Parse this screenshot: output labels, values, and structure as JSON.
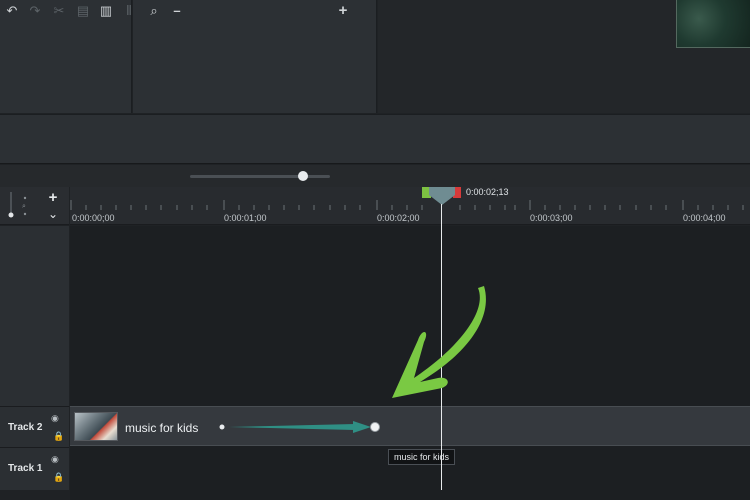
{
  "toolbar": {
    "undo": "↶",
    "redo": "↷",
    "cut": "✂",
    "copy": "▤",
    "paste": "▥",
    "split": "⫴",
    "zoom_icon": "⌕",
    "zoom_out": "–",
    "zoom_in": "+",
    "zoom_level": 0.8
  },
  "playhead": {
    "time": "0:00:02;13",
    "in_color": "#7dc142",
    "out_color": "#d63a3a",
    "head_color": "#6f8c92"
  },
  "ruler": {
    "labels": [
      "0:00:00;00",
      "0:00:01;00",
      "0:00:02;00",
      "0:00:03;00",
      "0:00:04;00"
    ]
  },
  "tracks": [
    {
      "name": "Track 2",
      "eye": "◉",
      "lock": "🔒"
    },
    {
      "name": "Track 1",
      "eye": "◉",
      "lock": "🔒"
    }
  ],
  "head_controls": {
    "add": "+",
    "collapse": "⌄"
  },
  "clip": {
    "label": "music for kids",
    "tooltip": "music for kids"
  },
  "annotation": {
    "arrow_color": "#7ac943",
    "line_color": "#2f8f84"
  }
}
